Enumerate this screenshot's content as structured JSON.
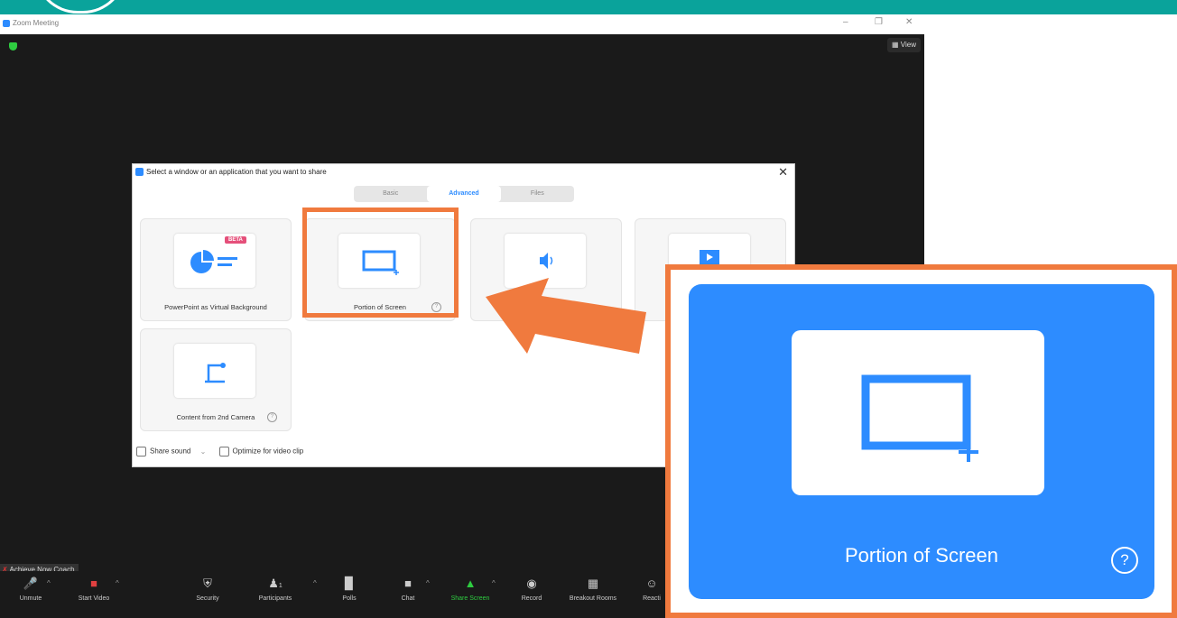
{
  "window": {
    "title": "Zoom Meeting",
    "view_label": "View"
  },
  "dialog": {
    "title": "Select a window or an application that you want to share",
    "tabs": [
      {
        "label": "Basic",
        "active": false
      },
      {
        "label": "Advanced",
        "active": true
      },
      {
        "label": "Files",
        "active": false
      }
    ],
    "cards": [
      {
        "label": "PowerPoint as Virtual Background",
        "badge": "BETA",
        "icon": "powerpoint-icon"
      },
      {
        "label": "Portion of Screen",
        "icon": "portion-screen-icon",
        "help": "?"
      },
      {
        "label": "",
        "icon": "computer-audio-icon"
      },
      {
        "label": "",
        "icon": "video-icon"
      },
      {
        "label": "Content from 2nd Camera",
        "icon": "camera-icon",
        "help": "?"
      }
    ],
    "share_sound_label": "Share sound",
    "optimize_label": "Optimize for video clip"
  },
  "participant_name": "Achieve Now Coach",
  "toolbar": {
    "buttons": [
      {
        "label": "Unmute",
        "icon": "mic-muted-icon"
      },
      {
        "label": "Start Video",
        "icon": "video-off-icon"
      },
      {
        "label": "Security",
        "icon": "shield-icon"
      },
      {
        "label": "Participants",
        "icon": "participants-icon",
        "count": "1"
      },
      {
        "label": "Polls",
        "icon": "polls-icon"
      },
      {
        "label": "Chat",
        "icon": "chat-icon"
      },
      {
        "label": "Share Screen",
        "icon": "share-screen-icon"
      },
      {
        "label": "Record",
        "icon": "record-icon"
      },
      {
        "label": "Breakout Rooms",
        "icon": "breakout-rooms-icon"
      },
      {
        "label": "Reacti",
        "icon": "reactions-icon"
      }
    ]
  },
  "zoom_inset": {
    "label": "Portion of Screen",
    "help": "?"
  },
  "colors": {
    "accent_blue": "#2d8cff",
    "highlight_orange": "#f07a3e",
    "teal": "#0aa39b",
    "share_green": "#2ecc40"
  }
}
